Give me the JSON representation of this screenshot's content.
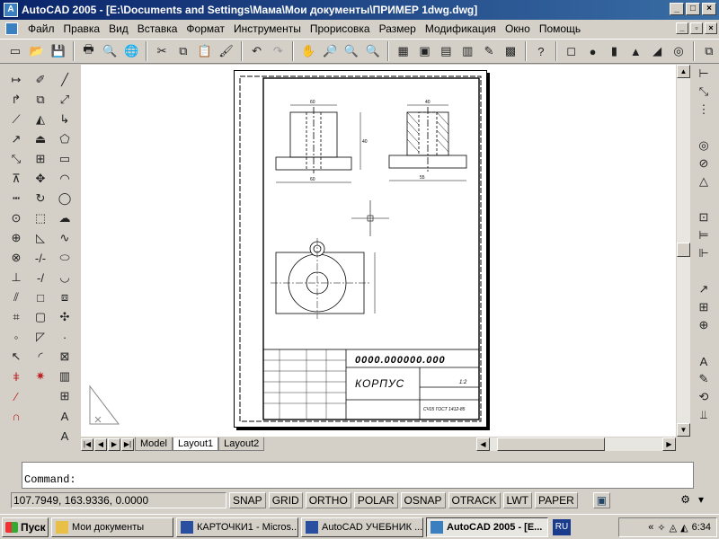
{
  "window": {
    "title": "AutoCAD 2005 - [E:\\Documents and Settings\\Мама\\Мои документы\\ПРИМЕР 1dwg.dwg]"
  },
  "menu": [
    "Файл",
    "Правка",
    "Вид",
    "Вставка",
    "Формат",
    "Инструменты",
    "Прорисовка",
    "Размер",
    "Модификация",
    "Окно",
    "Помощь"
  ],
  "drawing": {
    "stamp_code": "0000.000000.000",
    "part_name": "КОРПУС",
    "scale": "1:2",
    "material": "СЧ15 ГОСТ 1412-85",
    "dims": {
      "top_width": "60",
      "height": "40",
      "right_top": "40",
      "right_bottom": "55"
    }
  },
  "tabs": [
    "Model",
    "Layout1",
    "Layout2"
  ],
  "active_tab": "Layout1",
  "command": {
    "prompt": "Command:"
  },
  "status": {
    "coords": "107.7949, 163.9336, 0.0000",
    "toggles": [
      "SNAP",
      "GRID",
      "ORTHO",
      "POLAR",
      "OSNAP",
      "OTRACK",
      "LWT",
      "PAPER"
    ]
  },
  "taskbar": {
    "start": "Пуск",
    "tasks": [
      {
        "label": "Мои документы",
        "active": false
      },
      {
        "label": "КАРТОЧКИ1 - Micros...",
        "active": false
      },
      {
        "label": "AutoCAD УЧЕБНИК ...",
        "active": false
      },
      {
        "label": "AutoCAD 2005 - [E...",
        "active": true
      }
    ],
    "lang": "RU",
    "clock": "6:34"
  }
}
